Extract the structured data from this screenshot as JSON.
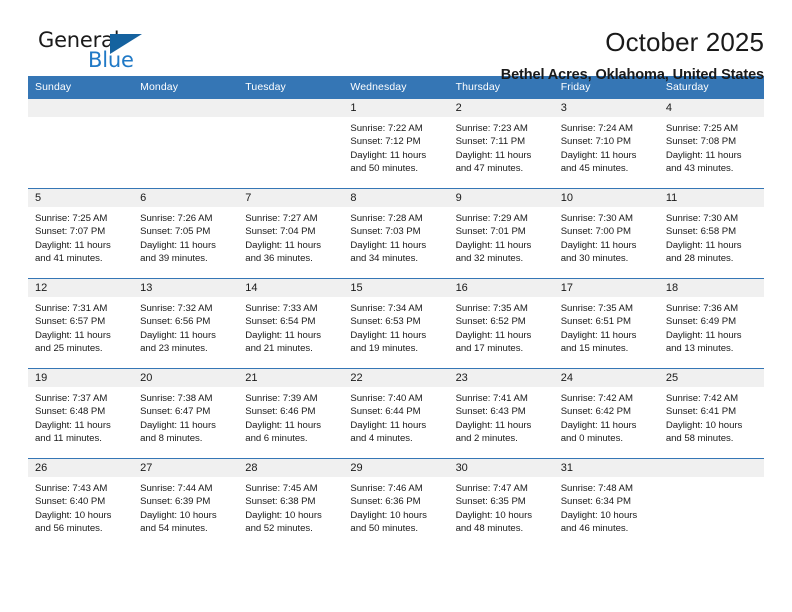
{
  "brand": {
    "name_part1": "General",
    "name_part2": "Blue",
    "triangle_color": "#15629f",
    "blue_text_color": "#2079c6"
  },
  "header": {
    "title": "October 2025",
    "subtitle": "Bethel Acres, Oklahoma, United States"
  },
  "theme": {
    "header_blue": "#3576b5",
    "daynum_band": "#f0f0f0",
    "text": "#1a1a1a"
  },
  "weekdays": [
    "Sunday",
    "Monday",
    "Tuesday",
    "Wednesday",
    "Thursday",
    "Friday",
    "Saturday"
  ],
  "weeks": [
    [
      {
        "day": "",
        "empty": true
      },
      {
        "day": "",
        "empty": true
      },
      {
        "day": "",
        "empty": true
      },
      {
        "day": "1",
        "sunrise": "Sunrise: 7:22 AM",
        "sunset": "Sunset: 7:12 PM",
        "daylight_line1": "Daylight: 11 hours",
        "daylight_line2": "and 50 minutes."
      },
      {
        "day": "2",
        "sunrise": "Sunrise: 7:23 AM",
        "sunset": "Sunset: 7:11 PM",
        "daylight_line1": "Daylight: 11 hours",
        "daylight_line2": "and 47 minutes."
      },
      {
        "day": "3",
        "sunrise": "Sunrise: 7:24 AM",
        "sunset": "Sunset: 7:10 PM",
        "daylight_line1": "Daylight: 11 hours",
        "daylight_line2": "and 45 minutes."
      },
      {
        "day": "4",
        "sunrise": "Sunrise: 7:25 AM",
        "sunset": "Sunset: 7:08 PM",
        "daylight_line1": "Daylight: 11 hours",
        "daylight_line2": "and 43 minutes."
      }
    ],
    [
      {
        "day": "5",
        "sunrise": "Sunrise: 7:25 AM",
        "sunset": "Sunset: 7:07 PM",
        "daylight_line1": "Daylight: 11 hours",
        "daylight_line2": "and 41 minutes."
      },
      {
        "day": "6",
        "sunrise": "Sunrise: 7:26 AM",
        "sunset": "Sunset: 7:05 PM",
        "daylight_line1": "Daylight: 11 hours",
        "daylight_line2": "and 39 minutes."
      },
      {
        "day": "7",
        "sunrise": "Sunrise: 7:27 AM",
        "sunset": "Sunset: 7:04 PM",
        "daylight_line1": "Daylight: 11 hours",
        "daylight_line2": "and 36 minutes."
      },
      {
        "day": "8",
        "sunrise": "Sunrise: 7:28 AM",
        "sunset": "Sunset: 7:03 PM",
        "daylight_line1": "Daylight: 11 hours",
        "daylight_line2": "and 34 minutes."
      },
      {
        "day": "9",
        "sunrise": "Sunrise: 7:29 AM",
        "sunset": "Sunset: 7:01 PM",
        "daylight_line1": "Daylight: 11 hours",
        "daylight_line2": "and 32 minutes."
      },
      {
        "day": "10",
        "sunrise": "Sunrise: 7:30 AM",
        "sunset": "Sunset: 7:00 PM",
        "daylight_line1": "Daylight: 11 hours",
        "daylight_line2": "and 30 minutes."
      },
      {
        "day": "11",
        "sunrise": "Sunrise: 7:30 AM",
        "sunset": "Sunset: 6:58 PM",
        "daylight_line1": "Daylight: 11 hours",
        "daylight_line2": "and 28 minutes."
      }
    ],
    [
      {
        "day": "12",
        "sunrise": "Sunrise: 7:31 AM",
        "sunset": "Sunset: 6:57 PM",
        "daylight_line1": "Daylight: 11 hours",
        "daylight_line2": "and 25 minutes."
      },
      {
        "day": "13",
        "sunrise": "Sunrise: 7:32 AM",
        "sunset": "Sunset: 6:56 PM",
        "daylight_line1": "Daylight: 11 hours",
        "daylight_line2": "and 23 minutes."
      },
      {
        "day": "14",
        "sunrise": "Sunrise: 7:33 AM",
        "sunset": "Sunset: 6:54 PM",
        "daylight_line1": "Daylight: 11 hours",
        "daylight_line2": "and 21 minutes."
      },
      {
        "day": "15",
        "sunrise": "Sunrise: 7:34 AM",
        "sunset": "Sunset: 6:53 PM",
        "daylight_line1": "Daylight: 11 hours",
        "daylight_line2": "and 19 minutes."
      },
      {
        "day": "16",
        "sunrise": "Sunrise: 7:35 AM",
        "sunset": "Sunset: 6:52 PM",
        "daylight_line1": "Daylight: 11 hours",
        "daylight_line2": "and 17 minutes."
      },
      {
        "day": "17",
        "sunrise": "Sunrise: 7:35 AM",
        "sunset": "Sunset: 6:51 PM",
        "daylight_line1": "Daylight: 11 hours",
        "daylight_line2": "and 15 minutes."
      },
      {
        "day": "18",
        "sunrise": "Sunrise: 7:36 AM",
        "sunset": "Sunset: 6:49 PM",
        "daylight_line1": "Daylight: 11 hours",
        "daylight_line2": "and 13 minutes."
      }
    ],
    [
      {
        "day": "19",
        "sunrise": "Sunrise: 7:37 AM",
        "sunset": "Sunset: 6:48 PM",
        "daylight_line1": "Daylight: 11 hours",
        "daylight_line2": "and 11 minutes."
      },
      {
        "day": "20",
        "sunrise": "Sunrise: 7:38 AM",
        "sunset": "Sunset: 6:47 PM",
        "daylight_line1": "Daylight: 11 hours",
        "daylight_line2": "and 8 minutes."
      },
      {
        "day": "21",
        "sunrise": "Sunrise: 7:39 AM",
        "sunset": "Sunset: 6:46 PM",
        "daylight_line1": "Daylight: 11 hours",
        "daylight_line2": "and 6 minutes."
      },
      {
        "day": "22",
        "sunrise": "Sunrise: 7:40 AM",
        "sunset": "Sunset: 6:44 PM",
        "daylight_line1": "Daylight: 11 hours",
        "daylight_line2": "and 4 minutes."
      },
      {
        "day": "23",
        "sunrise": "Sunrise: 7:41 AM",
        "sunset": "Sunset: 6:43 PM",
        "daylight_line1": "Daylight: 11 hours",
        "daylight_line2": "and 2 minutes."
      },
      {
        "day": "24",
        "sunrise": "Sunrise: 7:42 AM",
        "sunset": "Sunset: 6:42 PM",
        "daylight_line1": "Daylight: 11 hours",
        "daylight_line2": "and 0 minutes."
      },
      {
        "day": "25",
        "sunrise": "Sunrise: 7:42 AM",
        "sunset": "Sunset: 6:41 PM",
        "daylight_line1": "Daylight: 10 hours",
        "daylight_line2": "and 58 minutes."
      }
    ],
    [
      {
        "day": "26",
        "sunrise": "Sunrise: 7:43 AM",
        "sunset": "Sunset: 6:40 PM",
        "daylight_line1": "Daylight: 10 hours",
        "daylight_line2": "and 56 minutes."
      },
      {
        "day": "27",
        "sunrise": "Sunrise: 7:44 AM",
        "sunset": "Sunset: 6:39 PM",
        "daylight_line1": "Daylight: 10 hours",
        "daylight_line2": "and 54 minutes."
      },
      {
        "day": "28",
        "sunrise": "Sunrise: 7:45 AM",
        "sunset": "Sunset: 6:38 PM",
        "daylight_line1": "Daylight: 10 hours",
        "daylight_line2": "and 52 minutes."
      },
      {
        "day": "29",
        "sunrise": "Sunrise: 7:46 AM",
        "sunset": "Sunset: 6:36 PM",
        "daylight_line1": "Daylight: 10 hours",
        "daylight_line2": "and 50 minutes."
      },
      {
        "day": "30",
        "sunrise": "Sunrise: 7:47 AM",
        "sunset": "Sunset: 6:35 PM",
        "daylight_line1": "Daylight: 10 hours",
        "daylight_line2": "and 48 minutes."
      },
      {
        "day": "31",
        "sunrise": "Sunrise: 7:48 AM",
        "sunset": "Sunset: 6:34 PM",
        "daylight_line1": "Daylight: 10 hours",
        "daylight_line2": "and 46 minutes."
      },
      {
        "day": "",
        "empty": true
      }
    ]
  ]
}
